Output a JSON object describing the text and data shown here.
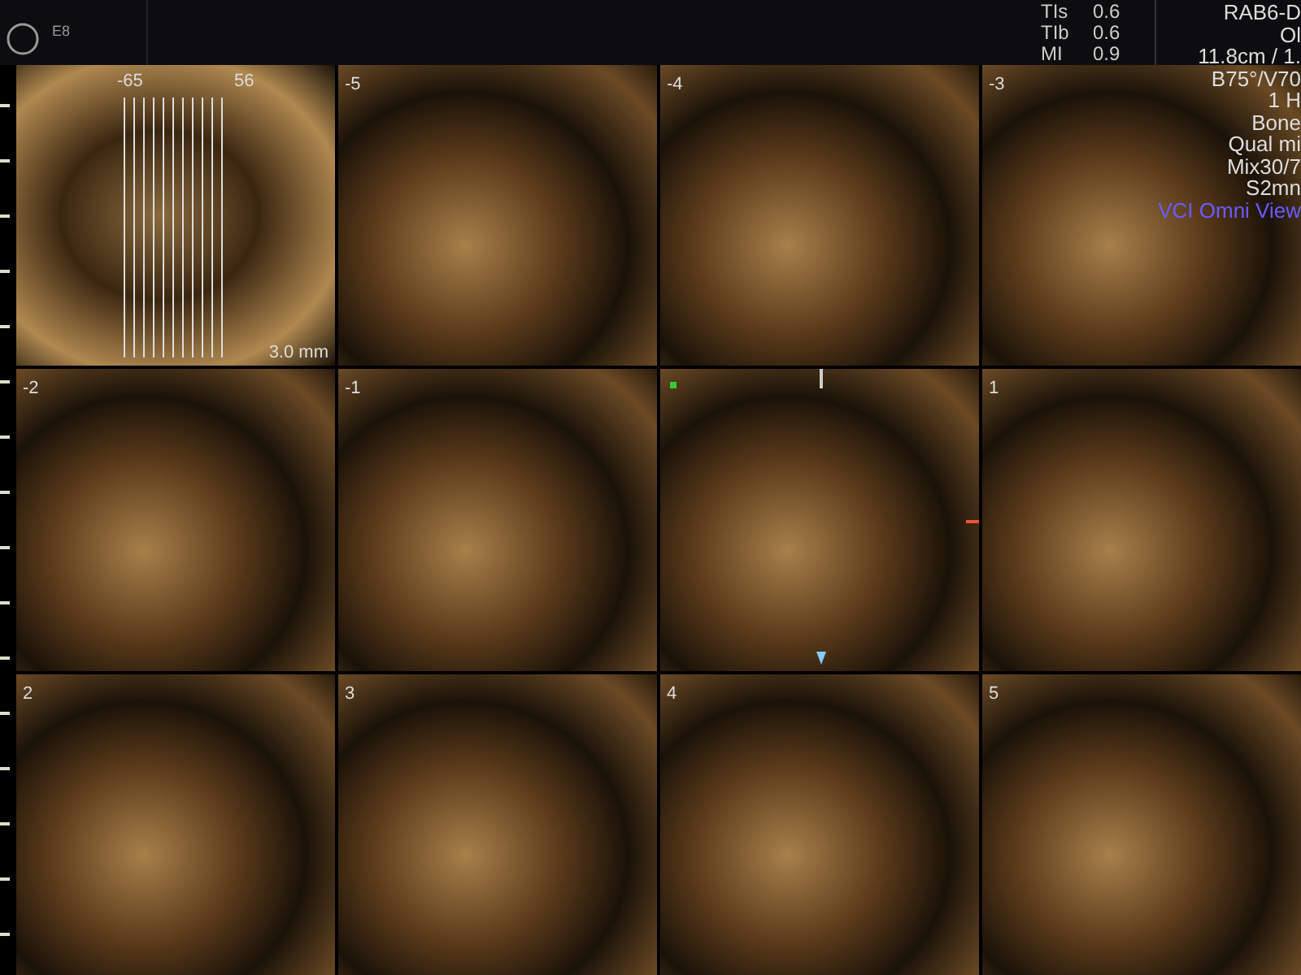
{
  "header": {
    "model": "E8",
    "indices": [
      {
        "label": "TIs",
        "value": "0.6"
      },
      {
        "label": "TIb",
        "value": "0.6"
      },
      {
        "label": "MI",
        "value": "0.9"
      }
    ]
  },
  "settings": [
    "RAB6-D",
    "Ol",
    "11.8cm / 1.",
    "B75°/V70",
    "1 H",
    "Bone",
    "Qual mi",
    "Mix30/7",
    "S2mn"
  ],
  "mode_label": "VCI Omni View",
  "reference_image": {
    "left_bound": "-65",
    "right_bound": "56",
    "slice_thickness": "3.0 mm"
  },
  "slices": [
    {
      "label": "-5"
    },
    {
      "label": "-4"
    },
    {
      "label": "-3"
    },
    {
      "label": "-2"
    },
    {
      "label": "-1"
    },
    {
      "kind": "center"
    },
    {
      "label": "1"
    },
    {
      "label": "2"
    },
    {
      "label": "3"
    },
    {
      "label": "4"
    },
    {
      "label": "5"
    }
  ]
}
